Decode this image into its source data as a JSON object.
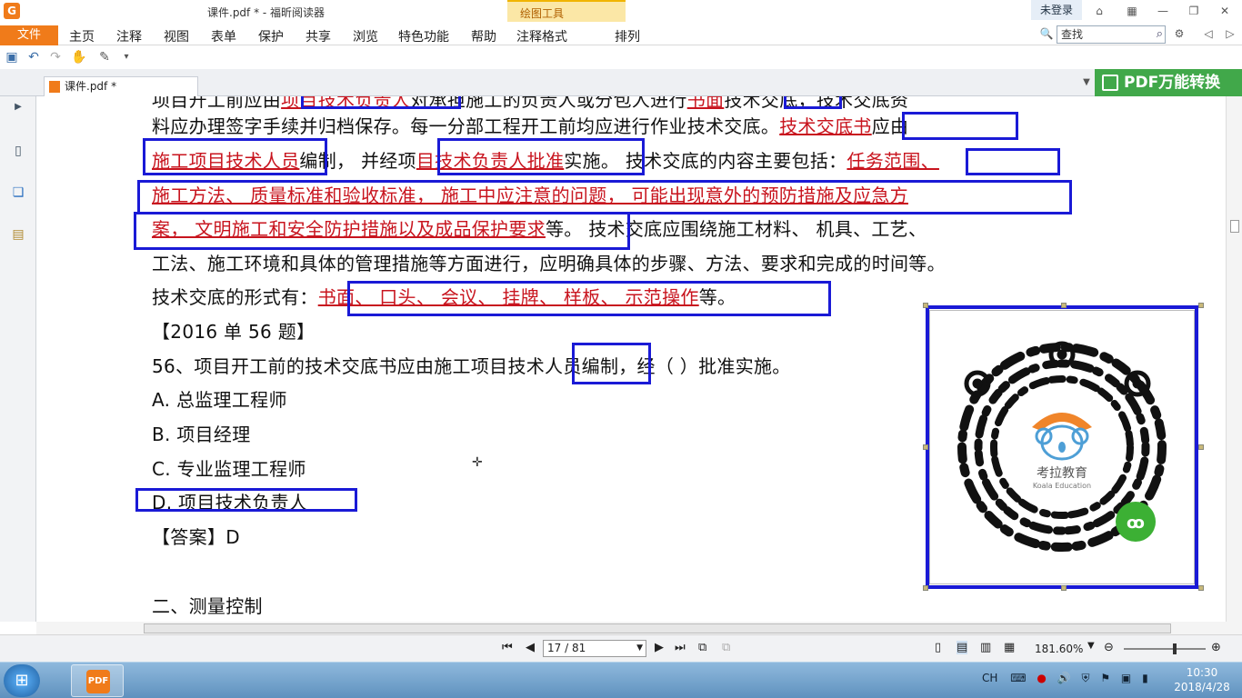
{
  "app": {
    "title": "课件.pdf * - 福昕阅读器",
    "logo": "G",
    "context_tab": "绘图工具",
    "login": "未登录"
  },
  "menu": {
    "file": "文件",
    "items": [
      "主页",
      "注释",
      "视图",
      "表单",
      "保护",
      "共享",
      "浏览",
      "特色功能",
      "帮助",
      "注释格式",
      "排列"
    ]
  },
  "search": {
    "placeholder": "查找"
  },
  "tab": {
    "label": "课件.pdf *"
  },
  "promo": {
    "label": "PDF万能转换"
  },
  "document": {
    "line1": "项目开工前应由",
    "line1_h1": "项目技术负责人",
    "line1_mid": "对承担施工的负责人或分包人进行",
    "line1_h2": "书面",
    "line1_end": "技术交底，技术交底资",
    "line2_pre": "料应办理签字手续并归档保存。每一分部工程开工前均应进行作业技术交底。",
    "line2_h": "技术交底书",
    "line2_end": "应由",
    "line3_h1": "施工项目技术人员",
    "line3_mid": "编制， 并经项",
    "line3_h2": "目技术负责人批准",
    "line3_mid2": "实施。 技术交底的内容主要包括：",
    "line3_h3": "任务范围、",
    "line4_h": "施工方法、 质量标准和验收标准， 施工中应注意的问题， 可能出现意外的预防措施及应急方",
    "line5_h": "案， 文明施工和安全防护措施以及成品保护要求",
    "line5_end": "等。 技术交底应围绕施工材料、 机具、工艺、",
    "line6": "工法、施工环境和具体的管理措施等方面进行，应明确具体的步骤、方法、要求和完成的时间等。",
    "line7_pre": "技术交底的形式有：",
    "line7_h": "书面、 口头、 会议、 挂牌、 样板、 示范操作",
    "line7_end": "等。",
    "q_header": "【2016 单 56 题】",
    "question": "56、项目开工前的技术交底书应由施工项目技术人员编制，经（ ）批准实施。",
    "opt_a": "A. 总监理工程师",
    "opt_b": "B. 项目经理",
    "opt_c": "C. 专业监理工程师",
    "opt_d": "D. 项目技术负责人",
    "answer": "【答案】D",
    "section": "二、测量控制"
  },
  "qr": {
    "brand": "考拉教育",
    "brand_en": "Koala Education"
  },
  "nav": {
    "page": "17 / 81",
    "zoom": "181.60%"
  },
  "clock": {
    "time": "10:30",
    "date": "2018/4/28"
  },
  "tray": {
    "ime": "CH"
  }
}
